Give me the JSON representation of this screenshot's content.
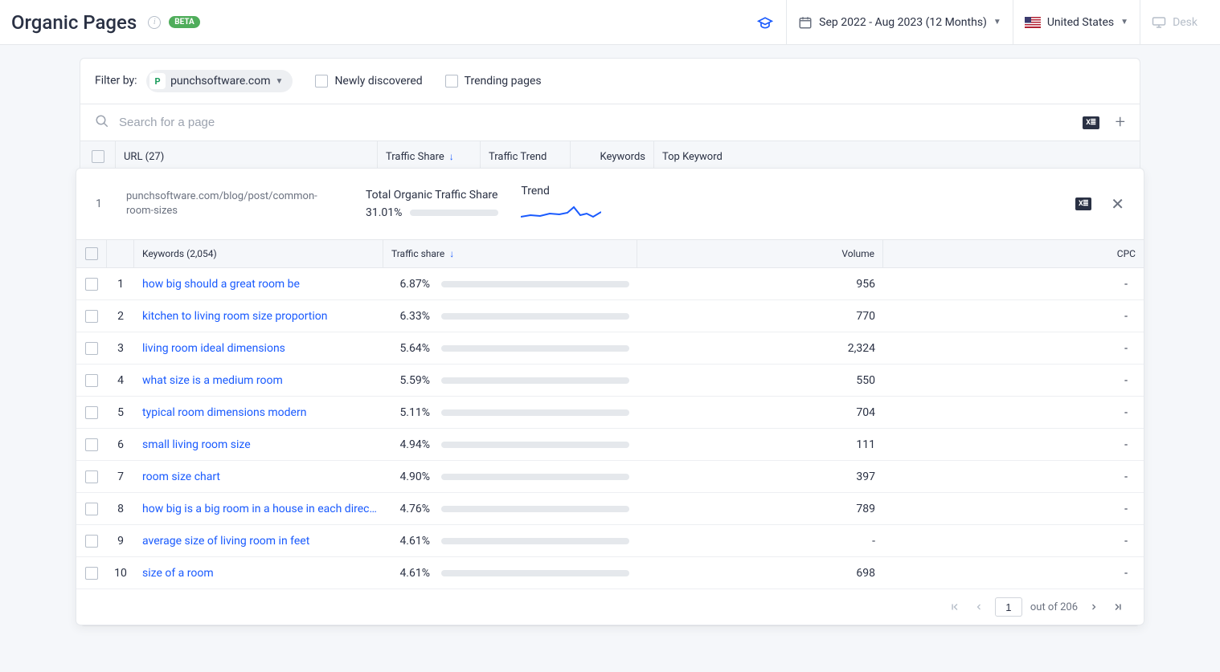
{
  "header": {
    "title": "Organic Pages",
    "beta_badge": "BETA",
    "date_range": "Sep 2022 - Aug 2023 (12 Months)",
    "country": "United States",
    "device": "Desk"
  },
  "filter": {
    "label": "Filter by:",
    "domain": "punchsoftware.com",
    "newly_discovered": "Newly discovered",
    "trending_pages": "Trending pages"
  },
  "search": {
    "placeholder": "Search for a page"
  },
  "outer_table": {
    "columns": {
      "url": "URL (27)",
      "traffic_share": "Traffic Share",
      "traffic_trend": "Traffic Trend",
      "keywords": "Keywords",
      "top_keyword": "Top Keyword"
    }
  },
  "expanded": {
    "number": "1",
    "url": "punchsoftware.com/blog/post/common-room-sizes",
    "metric_label": "Total Organic Traffic Share",
    "metric_value": "31.01%",
    "metric_bar_pct": 31.01,
    "trend_label": "Trend"
  },
  "inner_table": {
    "columns": {
      "keywords": "Keywords (2,054)",
      "traffic_share": "Traffic share",
      "volume": "Volume",
      "cpc": "CPC"
    },
    "rows": [
      {
        "n": "1",
        "keyword": "how big should a great room be",
        "share": "6.87%",
        "bar": 6.87,
        "volume": "956",
        "cpc": "-"
      },
      {
        "n": "2",
        "keyword": "kitchen to living room size proportion",
        "share": "6.33%",
        "bar": 6.33,
        "volume": "770",
        "cpc": "-"
      },
      {
        "n": "3",
        "keyword": "living room ideal dimensions",
        "share": "5.64%",
        "bar": 5.64,
        "volume": "2,324",
        "cpc": "-"
      },
      {
        "n": "4",
        "keyword": "what size is a medium room",
        "share": "5.59%",
        "bar": 5.59,
        "volume": "550",
        "cpc": "-"
      },
      {
        "n": "5",
        "keyword": "typical room dimensions modern",
        "share": "5.11%",
        "bar": 5.11,
        "volume": "704",
        "cpc": "-"
      },
      {
        "n": "6",
        "keyword": "small living room size",
        "share": "4.94%",
        "bar": 4.94,
        "volume": "111",
        "cpc": "-"
      },
      {
        "n": "7",
        "keyword": "room size chart",
        "share": "4.90%",
        "bar": 4.9,
        "volume": "397",
        "cpc": "-"
      },
      {
        "n": "8",
        "keyword": "how big is a big room in a house in each direc…",
        "share": "4.76%",
        "bar": 4.76,
        "volume": "789",
        "cpc": "-"
      },
      {
        "n": "9",
        "keyword": "average size of living room in feet",
        "share": "4.61%",
        "bar": 4.61,
        "volume": "-",
        "cpc": "-"
      },
      {
        "n": "10",
        "keyword": "size of a room",
        "share": "4.61%",
        "bar": 4.61,
        "volume": "698",
        "cpc": "-"
      }
    ]
  },
  "pagination": {
    "current": "1",
    "out_of": "out of 206"
  }
}
